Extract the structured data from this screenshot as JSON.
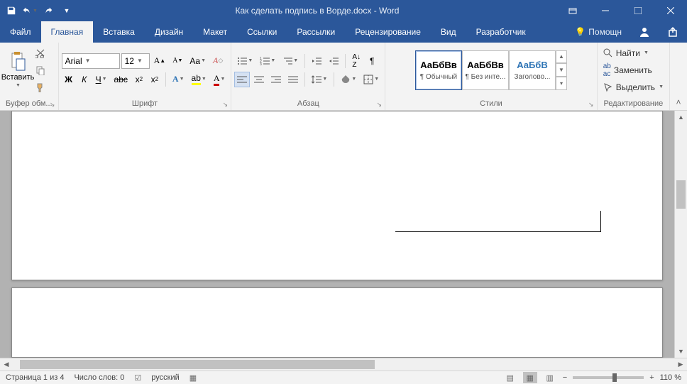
{
  "title": "Как сделать подпись в Ворде.docx - Word",
  "tabs": [
    "Файл",
    "Главная",
    "Вставка",
    "Дизайн",
    "Макет",
    "Ссылки",
    "Рассылки",
    "Рецензирование",
    "Вид",
    "Разработчик"
  ],
  "help": "Помощн",
  "font": {
    "name": "Arial",
    "size": "12"
  },
  "groups": {
    "clipboard": "Буфер обм...",
    "font": "Шрифт",
    "para": "Абзац",
    "styles": "Стили",
    "edit": "Редактирование"
  },
  "paste": "Вставить",
  "styles": [
    {
      "preview": "АаБбВв",
      "label": "¶ Обычный",
      "blue": false
    },
    {
      "preview": "АаБбВв",
      "label": "¶ Без инте...",
      "blue": false
    },
    {
      "preview": "АаБбВ",
      "label": "Заголово...",
      "blue": true
    }
  ],
  "editing": {
    "find": "Найти",
    "replace": "Заменить",
    "select": "Выделить"
  },
  "status": {
    "page": "Страница 1 из 4",
    "words": "Число слов: 0",
    "lang": "русский",
    "zoom": "110 %"
  }
}
